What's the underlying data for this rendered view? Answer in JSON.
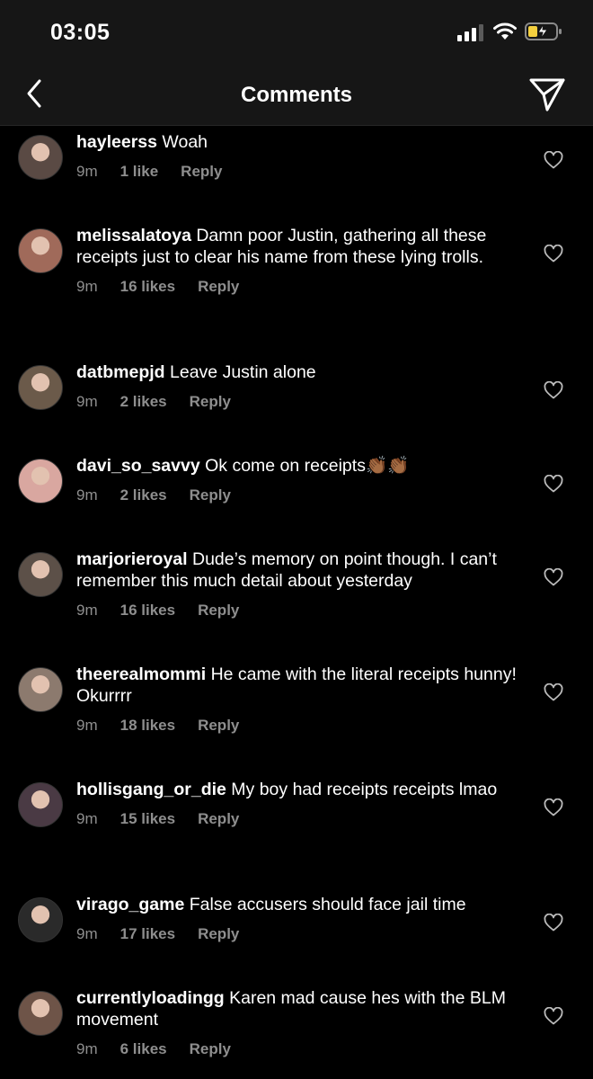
{
  "status_bar": {
    "time": "03:05",
    "signal_icon": "cellular-signal-icon",
    "wifi_icon": "wifi-icon",
    "battery_icon": "battery-charging-icon",
    "battery_color": "#f4d03f"
  },
  "nav": {
    "title": "Comments",
    "back_icon": "chevron-left-icon",
    "send_icon": "paper-plane-icon"
  },
  "colors": {
    "background": "#000000",
    "bar": "#161616",
    "meta_text": "#8e8e8e"
  },
  "comments": [
    {
      "username": "hayleerss",
      "text": "Woah",
      "time": "9m",
      "likes": "1 like",
      "reply": "Reply",
      "avatar_color": "#5a4a44"
    },
    {
      "username": "melissalatoya",
      "text": "Damn poor Justin, gathering all these receipts just to clear his name from these lying trolls.",
      "time": "9m",
      "likes": "16 likes",
      "reply": "Reply",
      "avatar_color": "#a06a5a"
    },
    {
      "username": "datbmepjd",
      "text": "Leave Justin alone",
      "time": "9m",
      "likes": "2 likes",
      "reply": "Reply",
      "avatar_color": "#6b5a4a"
    },
    {
      "username": "davi_so_savvy",
      "text": "Ok come on receipts👏🏾👏🏾",
      "time": "9m",
      "likes": "2 likes",
      "reply": "Reply",
      "avatar_color": "#d9a7a0"
    },
    {
      "username": "marjorieroyal",
      "text": "Dude’s memory on point though. I can’t remember this much detail about yesterday",
      "time": "9m",
      "likes": "16 likes",
      "reply": "Reply",
      "avatar_color": "#5c5048"
    },
    {
      "username": "theerealmommi",
      "text": "He came with the literal receipts hunny! Okurrrr",
      "time": "9m",
      "likes": "18 likes",
      "reply": "Reply",
      "avatar_color": "#8c7a6e"
    },
    {
      "username": "hollisgang_or_die",
      "text": "My boy had receipts receipts lmao",
      "time": "9m",
      "likes": "15 likes",
      "reply": "Reply",
      "avatar_color": "#4a3a44"
    },
    {
      "username": "virago_game",
      "text": "False accusers should face jail time",
      "time": "9m",
      "likes": "17 likes",
      "reply": "Reply",
      "avatar_color": "#2a2a2a"
    },
    {
      "username": "currentlyloadingg",
      "text": "Karen mad cause hes with the BLM movement",
      "time": "9m",
      "likes": "6 likes",
      "reply": "Reply",
      "avatar_color": "#6e5448"
    }
  ]
}
